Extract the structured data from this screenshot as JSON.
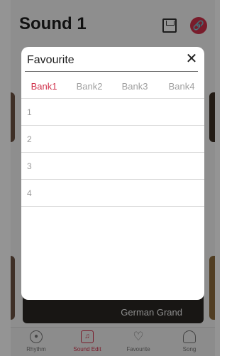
{
  "header": {
    "title": "Sound 1",
    "save_icon": "save-icon",
    "link_icon": "link-icon"
  },
  "background": {
    "card_label": "German Grand"
  },
  "tabbar": {
    "items": [
      {
        "label": "Rhythm",
        "icon": "rhythm-icon"
      },
      {
        "label": "Sound Edit",
        "icon": "music-note-icon",
        "active": true
      },
      {
        "label": "Favourite",
        "icon": "heart-icon"
      },
      {
        "label": "Song",
        "icon": "headphones-icon"
      }
    ]
  },
  "modal": {
    "title": "Favourite",
    "close_icon": "close-icon",
    "tabs": [
      "Bank1",
      "Bank2",
      "Bank3",
      "Bank4"
    ],
    "active_tab": "Bank1",
    "slots": [
      "1",
      "2",
      "3",
      "4"
    ]
  },
  "colors": {
    "accent": "#d0314b",
    "overlay": "rgba(0,0,0,0.42)"
  }
}
